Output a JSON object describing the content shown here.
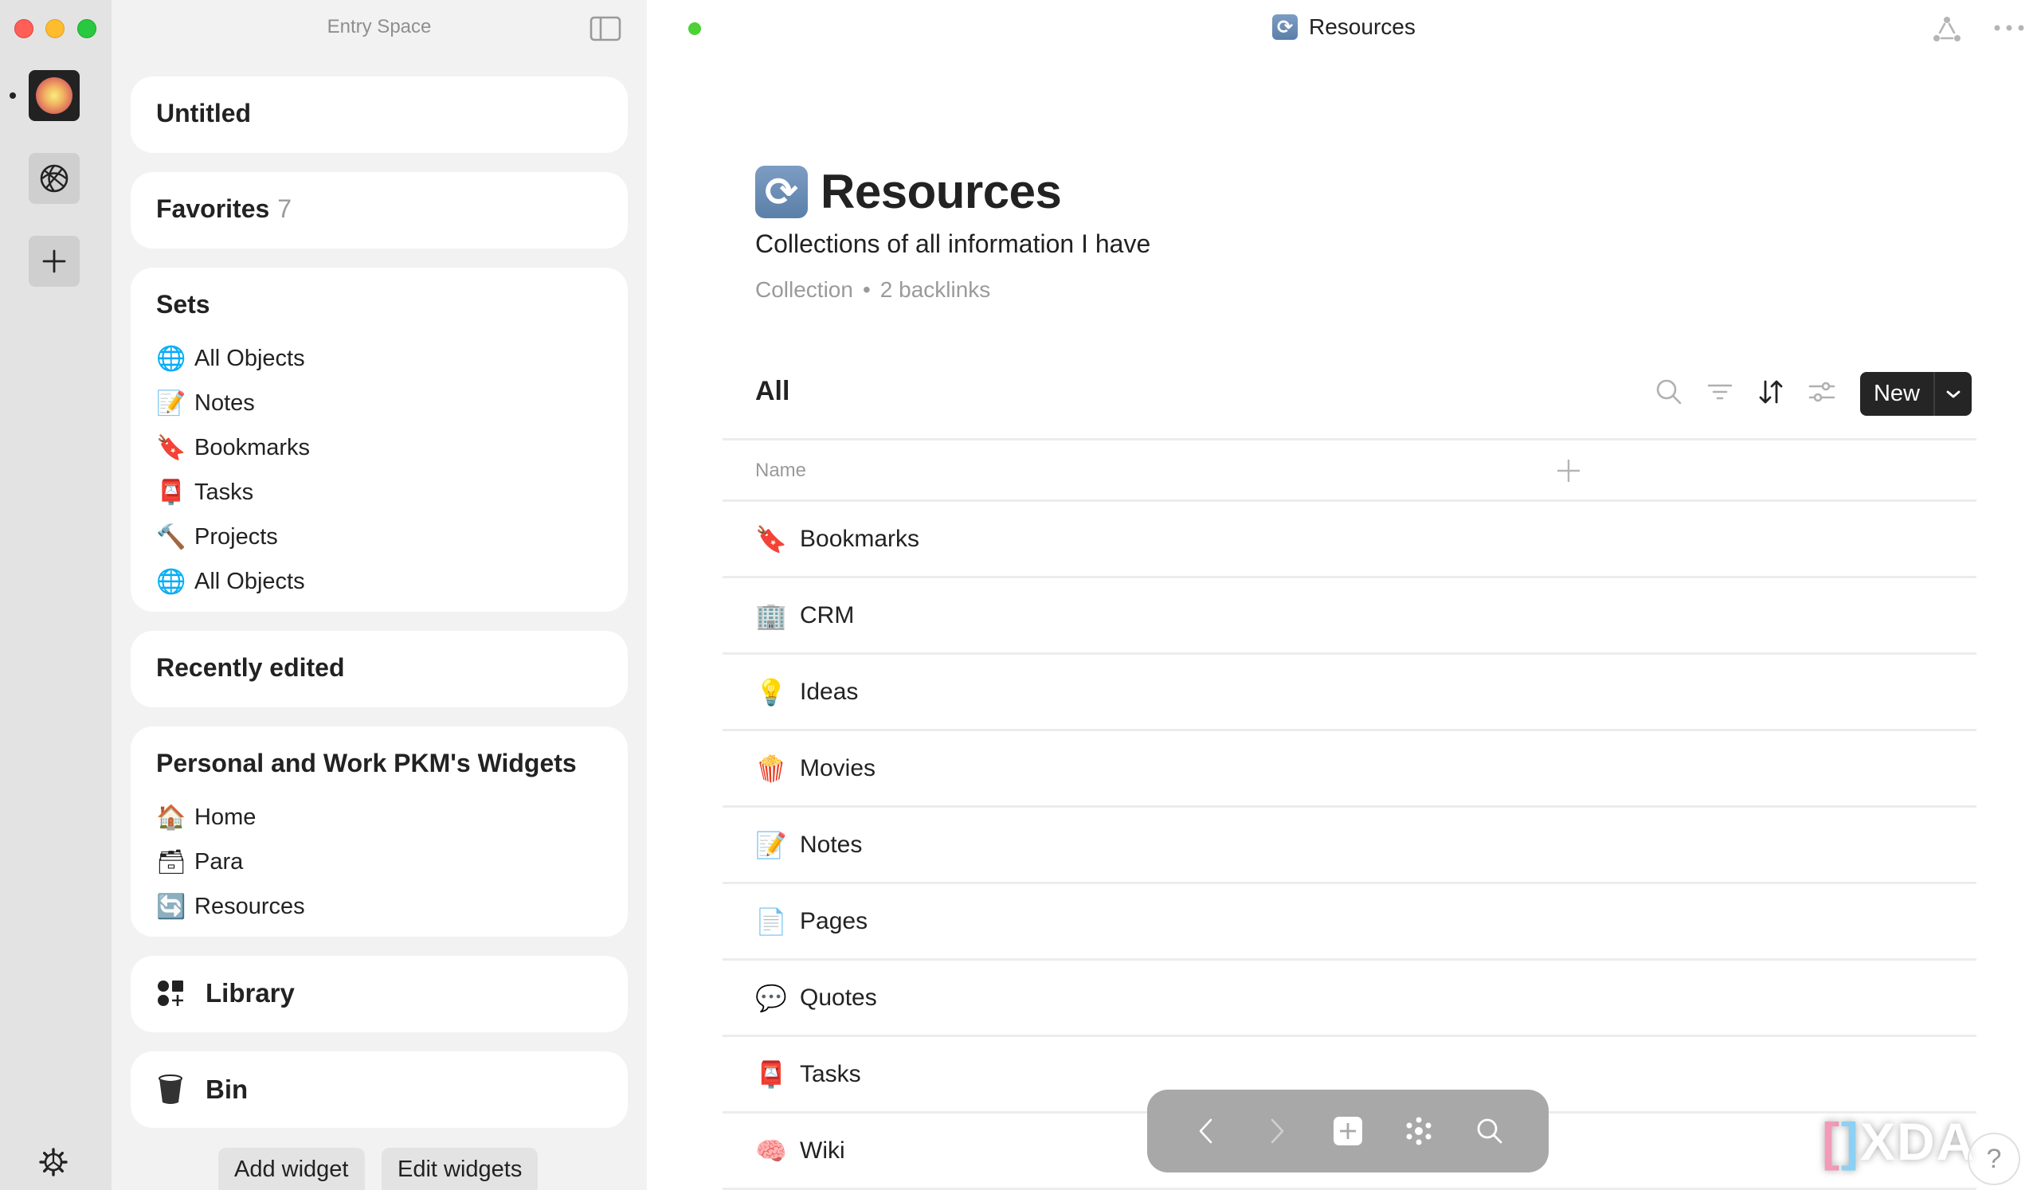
{
  "window": {
    "traffic_lights": [
      "close",
      "minimize",
      "zoom"
    ]
  },
  "rail": {
    "items": [
      {
        "name": "space-avatar",
        "active": true
      },
      {
        "name": "globe-icon"
      },
      {
        "name": "add-space",
        "label": "+"
      }
    ],
    "settings_icon": "gear-icon"
  },
  "sidebar": {
    "space_name": "Entry Space",
    "widgets": {
      "untitled": {
        "title": "Untitled"
      },
      "favorites": {
        "title": "Favorites",
        "count": "7"
      },
      "sets": {
        "title": "Sets",
        "items": [
          {
            "emoji": "🌐",
            "label": "All Objects"
          },
          {
            "emoji": "📝",
            "label": "Notes"
          },
          {
            "emoji": "🔖",
            "label": "Bookmarks"
          },
          {
            "emoji": "📮",
            "label": "Tasks"
          },
          {
            "emoji": "🔨",
            "label": "Projects"
          },
          {
            "emoji": "🌐",
            "label": "All Objects"
          }
        ]
      },
      "recently_edited": {
        "title": "Recently edited"
      },
      "pkm": {
        "title": "Personal and Work PKM's Widgets",
        "items": [
          {
            "emoji": "🏠",
            "label": "Home"
          },
          {
            "emoji": "🗃",
            "label": "Para"
          },
          {
            "emoji": "🔄",
            "label": "Resources"
          }
        ]
      },
      "library": {
        "title": "Library",
        "icon": "library-icon"
      },
      "bin": {
        "title": "Bin",
        "icon": "bin-icon"
      }
    },
    "buttons": {
      "add_widget": "Add widget",
      "edit_widgets": "Edit widgets"
    }
  },
  "header": {
    "status": "synced",
    "status_color": "#4cd137",
    "title": "Resources",
    "title_emoji": "🔄"
  },
  "page": {
    "emoji": "🔄",
    "title": "Resources",
    "description": "Collections of all information I have",
    "type": "Collection",
    "separator": "•",
    "backlinks": "2 backlinks"
  },
  "view": {
    "name": "All",
    "toolbar": {
      "search": "search-icon",
      "filter": "filter-icon",
      "sort": "sort-icon",
      "settings": "settings-icon"
    },
    "new_button": "New",
    "columns": [
      "Name"
    ],
    "rows": [
      {
        "emoji": "🔖",
        "name": "Bookmarks"
      },
      {
        "emoji": "🏢",
        "name": "CRM"
      },
      {
        "emoji": "💡",
        "name": "Ideas"
      },
      {
        "emoji": "🍿",
        "name": "Movies"
      },
      {
        "emoji": "📝",
        "name": "Notes"
      },
      {
        "emoji": "📄",
        "name": "Pages"
      },
      {
        "emoji": "💬",
        "name": "Quotes"
      },
      {
        "emoji": "📮",
        "name": "Tasks"
      },
      {
        "emoji": "🧠",
        "name": "Wiki"
      }
    ]
  },
  "floating_nav": {
    "buttons": [
      "back",
      "forward",
      "create",
      "graph",
      "search"
    ]
  },
  "watermark": {
    "text": "XDA",
    "help": "?"
  },
  "colors": {
    "rail_bg": "#e3e3e3",
    "sidebar_bg": "#f2f2f2",
    "card_bg": "#ffffff",
    "primary_button": "#252525",
    "floating_bar": "#a8a8a8",
    "text": "#222222",
    "muted_text": "#9a9a9a"
  }
}
